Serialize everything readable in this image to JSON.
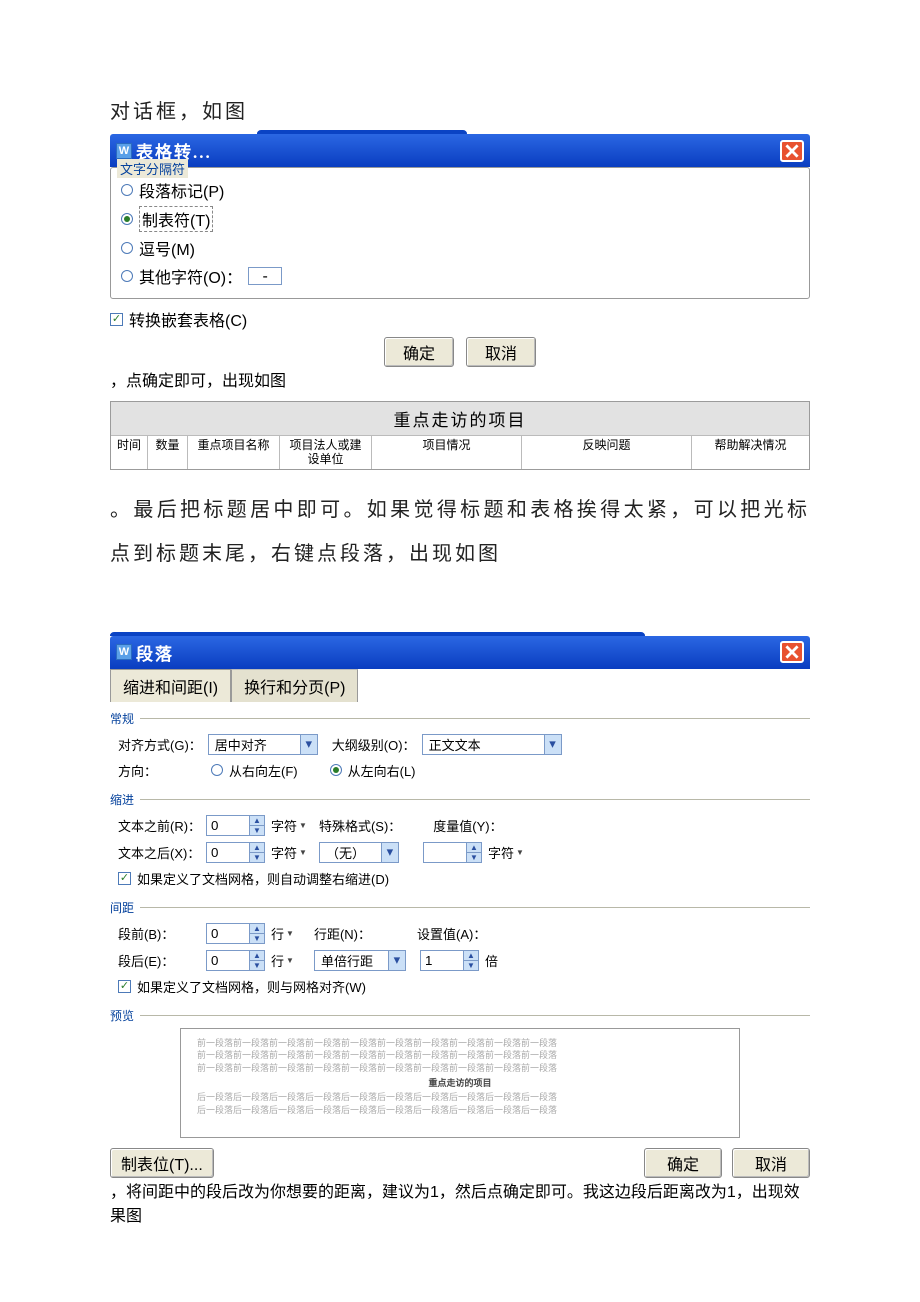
{
  "text": {
    "p1a": "对话框，如图",
    "p1b": "，点确定即可，出现如图",
    "p2": "。最后把标题居中即可。如果觉得标题和表格挨得太紧，可以把光标点到标题末尾，右键点段落，出现如图",
    "p3": "，将间距中的段后改为你想要的距离，建议为1，然后点确定即可。我这边段后距离改为1，出现效果图"
  },
  "dlg1": {
    "title": "表格转...",
    "legend": "文字分隔符",
    "opts": {
      "para": "段落标记(P)",
      "tab": "制表符(T)",
      "comma": "逗号(M)",
      "other": "其他字符(O)：",
      "other_val": "-"
    },
    "nested": "转换嵌套表格(C)",
    "ok": "确定",
    "cancel": "取消"
  },
  "sample": {
    "title": "重点走访的项目",
    "cols": [
      "时间",
      "数量",
      "重点项目名称",
      "项目法人或建设单位",
      "项目情况",
      "反映问题",
      "帮助解决情况"
    ]
  },
  "dlg2": {
    "title": "段落",
    "tabs": {
      "indent": "缩进和间距(I)",
      "page": "换行和分页(P)"
    },
    "sec": {
      "general": "常规",
      "indent": "缩进",
      "spacing": "间距",
      "preview": "预览"
    },
    "labels": {
      "align": "对齐方式(G)：",
      "outline": "大纲级别(O)：",
      "direction": "方向：",
      "rtl": "从右向左(F)",
      "ltr": "从左向右(L)",
      "before_text": "文本之前(R)：",
      "after_text": "文本之后(X)：",
      "char_unit": "字符",
      "special": "特殊格式(S)：",
      "measure": "度量值(Y)：",
      "auto_indent": "如果定义了文档网格，则自动调整右缩进(D)",
      "space_before": "段前(B)：",
      "space_after": "段后(E)：",
      "line_unit": "行",
      "line_spacing": "行距(N)：",
      "set_val": "设置值(A)：",
      "times": "倍",
      "snap": "如果定义了文档网格，则与网格对齐(W)",
      "tabstop": "制表位(T)...",
      "ok": "确定",
      "cancel": "取消"
    },
    "values": {
      "align": "居中对齐",
      "outline": "正文文本",
      "special": "（无）",
      "before_text": "0",
      "after_text": "0",
      "space_before": "0",
      "space_after": "0",
      "line_spacing": "单倍行距",
      "set_val": "1",
      "measure": ""
    },
    "preview_center": "重点走访的项目",
    "preview_line": "前一段落前一段落前一段落前一段落前一段落前一段落前一段落前一段落前一段落前一段落",
    "preview_line2": "后一段落后一段落后一段落后一段落后一段落后一段落后一段落后一段落后一段落后一段落"
  }
}
